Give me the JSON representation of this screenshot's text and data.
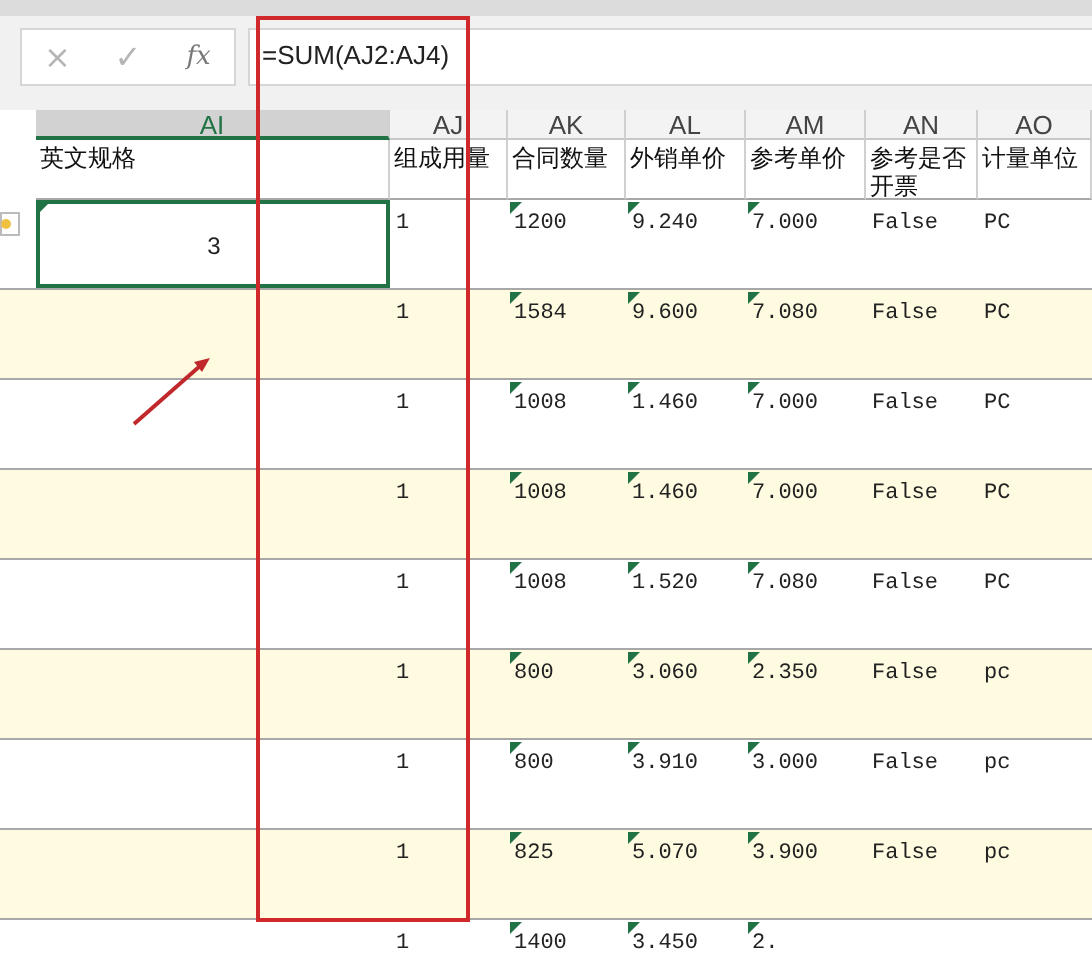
{
  "formula_bar": {
    "cancel": "×",
    "confirm": "✓",
    "function": "fx",
    "formula": "=SUM(AJ2:AJ4)"
  },
  "table": {
    "columns": [
      {
        "letter": "AI",
        "header": "英文规格",
        "selected": true
      },
      {
        "letter": "AJ",
        "header": "组成用量",
        "selected": false
      },
      {
        "letter": "AK",
        "header": "合同数量",
        "selected": false
      },
      {
        "letter": "AL",
        "header": "外销单价",
        "selected": false
      },
      {
        "letter": "AM",
        "header": "参考单价",
        "selected": false
      },
      {
        "letter": "AN",
        "header": "参考是否开票",
        "selected": false
      },
      {
        "letter": "AO",
        "header": "计量单位",
        "selected": false
      }
    ],
    "rows": [
      {
        "shaded": false,
        "warning": true,
        "cells": [
          {
            "v": "3",
            "flag": true,
            "selected": true
          },
          {
            "v": "1",
            "flag": false
          },
          {
            "v": "1200",
            "flag": true
          },
          {
            "v": "9.240",
            "flag": true
          },
          {
            "v": "7.000",
            "flag": true
          },
          {
            "v": "False",
            "flag": false
          },
          {
            "v": "PC",
            "flag": false
          }
        ]
      },
      {
        "shaded": true,
        "cells": [
          {},
          {
            "v": "1",
            "flag": false
          },
          {
            "v": "1584",
            "flag": true
          },
          {
            "v": "9.600",
            "flag": true
          },
          {
            "v": "7.080",
            "flag": true
          },
          {
            "v": "False",
            "flag": false
          },
          {
            "v": "PC",
            "flag": false
          }
        ]
      },
      {
        "shaded": false,
        "cells": [
          {},
          {
            "v": "1",
            "flag": false
          },
          {
            "v": "1008",
            "flag": true
          },
          {
            "v": "1.460",
            "flag": true
          },
          {
            "v": "7.000",
            "flag": true
          },
          {
            "v": "False",
            "flag": false
          },
          {
            "v": "PC",
            "flag": false
          }
        ]
      },
      {
        "shaded": true,
        "cells": [
          {},
          {
            "v": "1",
            "flag": false
          },
          {
            "v": "1008",
            "flag": true
          },
          {
            "v": "1.460",
            "flag": true
          },
          {
            "v": "7.000",
            "flag": true
          },
          {
            "v": "False",
            "flag": false
          },
          {
            "v": "PC",
            "flag": false
          }
        ]
      },
      {
        "shaded": false,
        "cells": [
          {},
          {
            "v": "1",
            "flag": false
          },
          {
            "v": "1008",
            "flag": true
          },
          {
            "v": "1.520",
            "flag": true
          },
          {
            "v": "7.080",
            "flag": true
          },
          {
            "v": "False",
            "flag": false
          },
          {
            "v": "PC",
            "flag": false
          }
        ]
      },
      {
        "shaded": true,
        "cells": [
          {},
          {
            "v": "1",
            "flag": false
          },
          {
            "v": "800",
            "flag": true
          },
          {
            "v": "3.060",
            "flag": true
          },
          {
            "v": "2.350",
            "flag": true
          },
          {
            "v": "False",
            "flag": false
          },
          {
            "v": "pc",
            "flag": false
          }
        ]
      },
      {
        "shaded": false,
        "cells": [
          {},
          {
            "v": "1",
            "flag": false
          },
          {
            "v": "800",
            "flag": true
          },
          {
            "v": "3.910",
            "flag": true
          },
          {
            "v": "3.000",
            "flag": true
          },
          {
            "v": "False",
            "flag": false
          },
          {
            "v": "pc",
            "flag": false
          }
        ]
      },
      {
        "shaded": true,
        "cells": [
          {},
          {
            "v": "1",
            "flag": false
          },
          {
            "v": "825",
            "flag": true
          },
          {
            "v": "5.070",
            "flag": true
          },
          {
            "v": "3.900",
            "flag": true
          },
          {
            "v": "False",
            "flag": false
          },
          {
            "v": "pc",
            "flag": false
          }
        ]
      },
      {
        "shaded": false,
        "cells": [
          {},
          {
            "v": "1",
            "flag": false
          },
          {
            "v": "1400",
            "flag": true
          },
          {
            "v": "3.450",
            "flag": true
          },
          {
            "v": "2.",
            "flag": true
          },
          {},
          {}
        ]
      }
    ]
  }
}
